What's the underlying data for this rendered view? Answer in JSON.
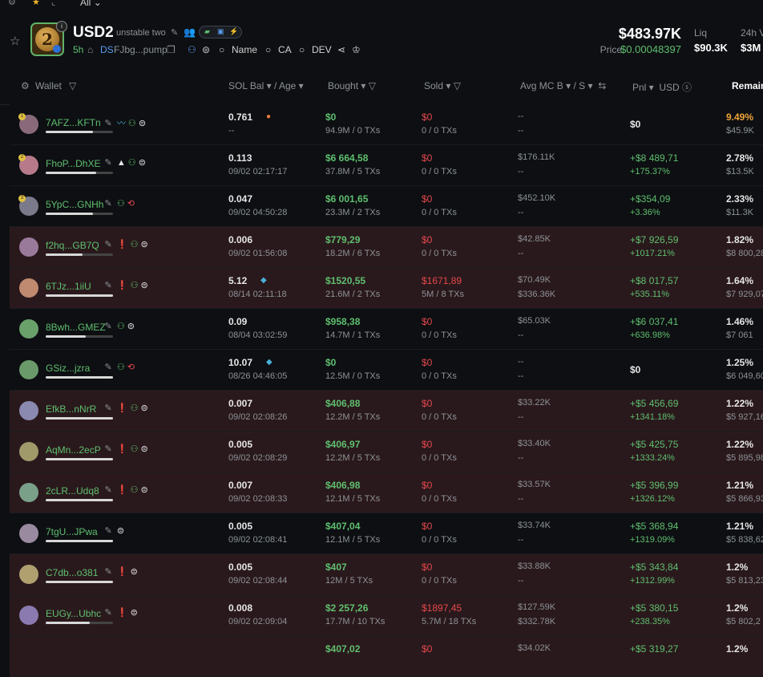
{
  "topbar": {
    "filter_label": "All"
  },
  "token": {
    "symbol": "USD2",
    "name": "unstable two",
    "age": "5h",
    "ds": "DS",
    "address": "FJbg...pump",
    "name_search": "Name",
    "ca_search": "CA",
    "dev_search": "DEV",
    "market_cap": "$483.97K",
    "price_label": "Price",
    "price": "$0.00048397",
    "liq_label": "Liq",
    "liq_value": "$90.3K",
    "vol_label": "24h V",
    "vol_value": "$3M",
    "logo_digit": "2"
  },
  "columns": {
    "wallet": "Wallet",
    "sol_bal": "SOL Bal",
    "age": "Age",
    "bought": "Bought",
    "sold": "Sold",
    "avg_mc": "Avg MC B",
    "avg_mc_s": "S",
    "pnl": "Pnl",
    "usd": "USD",
    "remaining": "Remain"
  },
  "rows": [
    {
      "wallet": "7AFZ...KFTn",
      "bar": 0.7,
      "sol": "0.761",
      "age": "--",
      "bought": "$0",
      "bought_sub": "94.9M / 0 TXs",
      "sold": "$0",
      "sold_sub": "0 / 0 TXs",
      "mc_b": "--",
      "mc_s": "--",
      "pnl": "$0",
      "pnl_pct": "",
      "rem": "9.49%",
      "rem_sub": "$45.9K",
      "hl": false,
      "orange": true,
      "icons": "fish",
      "rank": "1"
    },
    {
      "wallet": "FhoP...DhXE",
      "bar": 0.75,
      "sol": "0.113",
      "age": "09/02 02:17:17",
      "bought": "$6 664,58",
      "bought_sub": "37.8M / 5 TXs",
      "sold": "$0",
      "sold_sub": "0 / 0 TXs",
      "mc_b": "$176.11K",
      "mc_s": "--",
      "pnl": "+$8 489,71",
      "pnl_pct": "+175.37%",
      "rem": "2.78%",
      "rem_sub": "$13.5K",
      "hl": false,
      "icons": "a",
      "rank": "2"
    },
    {
      "wallet": "5YpC...GNHh",
      "bar": 0.7,
      "sol": "0.047",
      "age": "09/02 04:50:28",
      "bought": "$6 001,65",
      "bought_sub": "23.3M / 2 TXs",
      "sold": "$0",
      "sold_sub": "0 / 0 TXs",
      "mc_b": "$452.10K",
      "mc_s": "--",
      "pnl": "+$354,09",
      "pnl_pct": "+3.36%",
      "rem": "2.33%",
      "rem_sub": "$11.3K",
      "hl": false,
      "icons": "b",
      "rank": "3"
    },
    {
      "wallet": "f2hq...GB7Q",
      "bar": 0.55,
      "sol": "0.006",
      "age": "09/02 01:56:08",
      "bought": "$779,29",
      "bought_sub": "18.2M / 6 TXs",
      "sold": "$0",
      "sold_sub": "0 / 0 TXs",
      "mc_b": "$42.85K",
      "mc_s": "--",
      "pnl": "+$7 926,59",
      "pnl_pct": "+1017.21%",
      "rem": "1.82%",
      "rem_sub": "$8 800,28",
      "hl": true,
      "icons": "c",
      "rank": ""
    },
    {
      "wallet": "6TJz...1iiU",
      "bar": 1.0,
      "sol": "5.12",
      "age": "08/14 02:11:18",
      "bought": "$1520,55",
      "bought_sub": "21.6M / 2 TXs",
      "sold": "$1671,89",
      "sold_sub": "5M / 8 TXs",
      "mc_b": "$70.49K",
      "mc_s": "$336.36K",
      "pnl": "+$8 017,57",
      "pnl_pct": "+535.11%",
      "rem": "1.64%",
      "rem_sub": "$7 929,07",
      "hl": true,
      "icons": "c",
      "rank": ""
    },
    {
      "wallet": "8Bwh...GMEZ",
      "bar": 0.6,
      "sol": "0.09",
      "age": "08/04 03:02:59",
      "bought": "$958,38",
      "bought_sub": "14.7M / 1 TXs",
      "sold": "$0",
      "sold_sub": "0 / 0 TXs",
      "mc_b": "$65.03K",
      "mc_s": "--",
      "pnl": "+$6 037,41",
      "pnl_pct": "+636.98%",
      "rem": "1.46%",
      "rem_sub": "$7 061",
      "hl": false,
      "icons": "d",
      "rank": ""
    },
    {
      "wallet": "GSiz...jzra",
      "bar": 1.0,
      "sol": "10.07",
      "age": "08/26 04:46:05",
      "bought": "$0",
      "bought_sub": "12.5M / 0 TXs",
      "sold": "$0",
      "sold_sub": "0 / 0 TXs",
      "mc_b": "--",
      "mc_s": "--",
      "pnl": "$0",
      "pnl_pct": "",
      "rem": "1.25%",
      "rem_sub": "$6 049,60",
      "hl": false,
      "icons": "b",
      "rank": ""
    },
    {
      "wallet": "EfkB...nNrR",
      "bar": 1.0,
      "sol": "0.007",
      "age": "09/02 02:08:26",
      "bought": "$406,88",
      "bought_sub": "12.2M / 5 TXs",
      "sold": "$0",
      "sold_sub": "0 / 0 TXs",
      "mc_b": "$33.22K",
      "mc_s": "--",
      "pnl": "+$5 456,69",
      "pnl_pct": "+1341.18%",
      "rem": "1.22%",
      "rem_sub": "$5 927,16",
      "hl": true,
      "icons": "c",
      "rank": ""
    },
    {
      "wallet": "AqMn...2ecP",
      "bar": 1.0,
      "sol": "0.005",
      "age": "09/02 02:08:29",
      "bought": "$406,97",
      "bought_sub": "12.2M / 5 TXs",
      "sold": "$0",
      "sold_sub": "0 / 0 TXs",
      "mc_b": "$33.40K",
      "mc_s": "--",
      "pnl": "+$5 425,75",
      "pnl_pct": "+1333.24%",
      "rem": "1.22%",
      "rem_sub": "$5 895,98",
      "hl": true,
      "icons": "c",
      "rank": ""
    },
    {
      "wallet": "2cLR...Udq8",
      "bar": 1.0,
      "sol": "0.007",
      "age": "09/02 02:08:33",
      "bought": "$406,98",
      "bought_sub": "12.1M / 5 TXs",
      "sold": "$0",
      "sold_sub": "0 / 0 TXs",
      "mc_b": "$33.57K",
      "mc_s": "--",
      "pnl": "+$5 396,99",
      "pnl_pct": "+1326.12%",
      "rem": "1.21%",
      "rem_sub": "$5 866,93",
      "hl": true,
      "icons": "c",
      "rank": ""
    },
    {
      "wallet": "7tgU...JPwa",
      "bar": 1.0,
      "sol": "0.005",
      "age": "09/02 02:08:41",
      "bought": "$407,04",
      "bought_sub": "12.1M / 5 TXs",
      "sold": "$0",
      "sold_sub": "0 / 0 TXs",
      "mc_b": "$33.74K",
      "mc_s": "--",
      "pnl": "+$5 368,94",
      "pnl_pct": "+1319.09%",
      "rem": "1.21%",
      "rem_sub": "$5 838,62",
      "hl": false,
      "icons": "e",
      "rank": ""
    },
    {
      "wallet": "C7db...o381",
      "bar": 1.0,
      "sol": "0.005",
      "age": "09/02 02:08:44",
      "bought": "$407",
      "bought_sub": "12M / 5 TXs",
      "sold": "$0",
      "sold_sub": "0 / 0 TXs",
      "mc_b": "$33.88K",
      "mc_s": "--",
      "pnl": "+$5 343,84",
      "pnl_pct": "+1312.99%",
      "rem": "1.2%",
      "rem_sub": "$5 813,23",
      "hl": true,
      "icons": "f",
      "rank": ""
    },
    {
      "wallet": "EUGy...Ubhc",
      "bar": 0.65,
      "sol": "0.008",
      "age": "09/02 02:09:04",
      "bought": "$2 257,26",
      "bought_sub": "17.7M / 10 TXs",
      "sold": "$1897,45",
      "sold_sub": "5.7M / 18 TXs",
      "mc_b": "$127.59K",
      "mc_s": "$332.78K",
      "pnl": "+$5 380,15",
      "pnl_pct": "+238.35%",
      "rem": "1.2%",
      "rem_sub": "$5 802,2",
      "hl": true,
      "icons": "f",
      "rank": ""
    },
    {
      "wallet": "",
      "bar": 0,
      "sol": "",
      "age": "",
      "bought": "$407,02",
      "bought_sub": "",
      "sold": "$0",
      "sold_sub": "",
      "mc_b": "$34.02K",
      "mc_s": "",
      "pnl": "+$5 319,27",
      "pnl_pct": "",
      "rem": "1.2%",
      "rem_sub": "",
      "hl": true,
      "icons": "",
      "rank": ""
    }
  ]
}
